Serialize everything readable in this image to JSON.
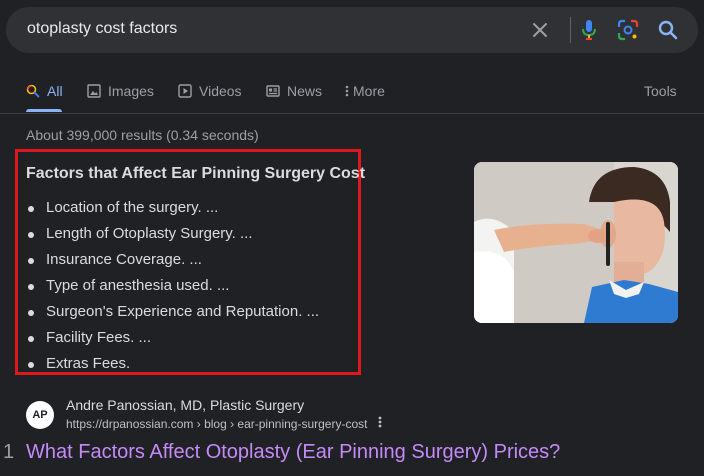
{
  "search": {
    "query": "otoplasty cost factors",
    "icons": [
      "close-icon",
      "microphone-icon",
      "lens-icon",
      "search-icon"
    ]
  },
  "tabs": [
    {
      "label": "All",
      "icon": "search-icon",
      "active": true
    },
    {
      "label": "Images",
      "icon": "image-icon"
    },
    {
      "label": "Videos",
      "icon": "play-icon"
    },
    {
      "label": "News",
      "icon": "news-icon"
    },
    {
      "label": "More",
      "icon": "vertical-dots-icon"
    }
  ],
  "tools_label": "Tools",
  "stats": "About 399,000 results (0.34 seconds)",
  "snippet": {
    "title": "Factors that Affect Ear Pinning Surgery Cost",
    "items": [
      "Location of the surgery. ...",
      "Length of Otoplasty Surgery. ...",
      "Insurance Coverage. ...",
      "Type of anesthesia used. ...",
      "Surgeon's Experience and Reputation. ...",
      "Facility Fees. ...",
      "Extras Fees."
    ],
    "highlight_color": "#e0181b"
  },
  "result": {
    "favicon_text": "AP",
    "site_name": "Andre Panossian, MD, Plastic Surgery",
    "url": "https://drpanossian.com › blog › ear-pinning-surgery-cost",
    "number": "1",
    "title": "What Factors Affect Otoplasty (Ear Pinning Surgery) Prices?"
  },
  "colors": {
    "background": "#202124",
    "link": "#8ab4f8",
    "visited_title": "#c58af9"
  }
}
